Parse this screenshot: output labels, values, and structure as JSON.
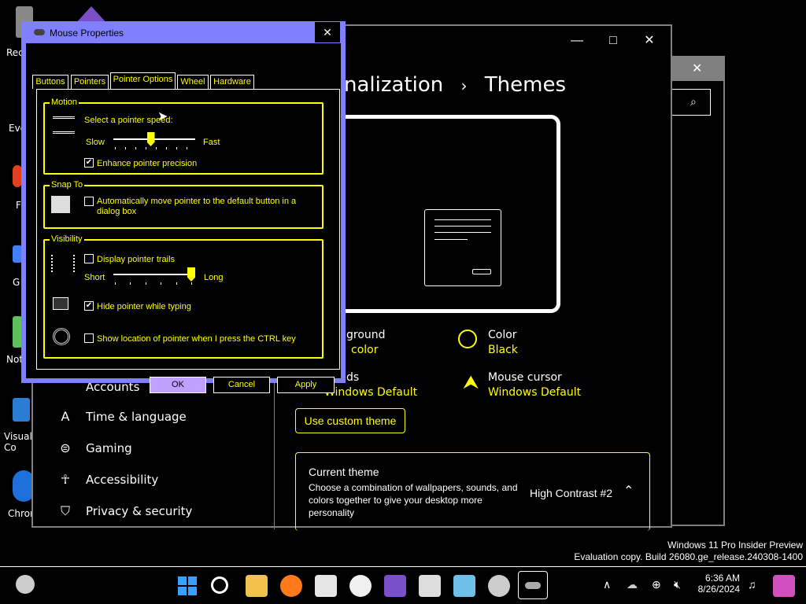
{
  "desktop": {
    "icons": [
      {
        "label": "Rec"
      },
      {
        "label": "Eve"
      },
      {
        "label": "F"
      },
      {
        "label": "G"
      },
      {
        "label": "Not"
      },
      {
        "label": "Visual\nCo"
      },
      {
        "label": "Chron"
      }
    ]
  },
  "settings": {
    "title_crumb_parent": "nalization",
    "title_crumb_sep": "›",
    "title_crumb_current": "Themes",
    "controls": {
      "minimize": "—",
      "maximize": "□",
      "close": "✕"
    },
    "options": [
      {
        "label": "ground",
        "value": "color"
      },
      {
        "label": "Color",
        "value": "Black"
      },
      {
        "label": "ds",
        "value": "Windows Default"
      },
      {
        "label": "Mouse cursor",
        "value": "Windows Default"
      }
    ],
    "use_custom_theme": "Use custom theme",
    "current_theme": {
      "heading": "Current theme",
      "description": "Choose a combination of wallpapers, sounds, and colors together to give your desktop more personality",
      "value": "High Contrast #2"
    },
    "nav": [
      {
        "label": "Accounts"
      },
      {
        "label": "Time & language"
      },
      {
        "label": "Gaming"
      },
      {
        "label": "Accessibility"
      },
      {
        "label": "Privacy & security"
      }
    ]
  },
  "mouse_dialog": {
    "title": "Mouse Properties",
    "close": "✕",
    "tabs": [
      "Buttons",
      "Pointers",
      "Pointer Options",
      "Wheel",
      "Hardware"
    ],
    "active_tab": "Pointer Options",
    "motion": {
      "group_label": "Motion",
      "speed_label": "Select a pointer speed:",
      "slow": "Slow",
      "fast": "Fast",
      "speed_value": 0.5,
      "enhance_label": "Enhance pointer precision",
      "enhance_checked": true
    },
    "snap": {
      "group_label": "Snap To",
      "snap_label": "Automatically move pointer to the default button in a dialog box",
      "snap_checked": false
    },
    "visibility": {
      "group_label": "Visibility",
      "trails_label": "Display pointer trails",
      "trails_checked": false,
      "short": "Short",
      "long": "Long",
      "trail_value": 1.0,
      "hide_label": "Hide pointer while typing",
      "hide_checked": true,
      "ctrl_label": "Show location of pointer when I press the CTRL key",
      "ctrl_checked": false
    },
    "buttons": {
      "ok": "OK",
      "cancel": "Cancel",
      "apply": "Apply"
    }
  },
  "watermark": {
    "line1": "Windows 11 Pro Insider Preview",
    "line2": "Evaluation copy. Build 26080.ge_release.240308-1400"
  },
  "taskbar": {
    "time": "6:36 AM",
    "date": "8/26/2024"
  },
  "colors": {
    "accent": "#ffff00",
    "dialog_frame": "#8080ff",
    "ok_button": "#c0a0ff"
  }
}
